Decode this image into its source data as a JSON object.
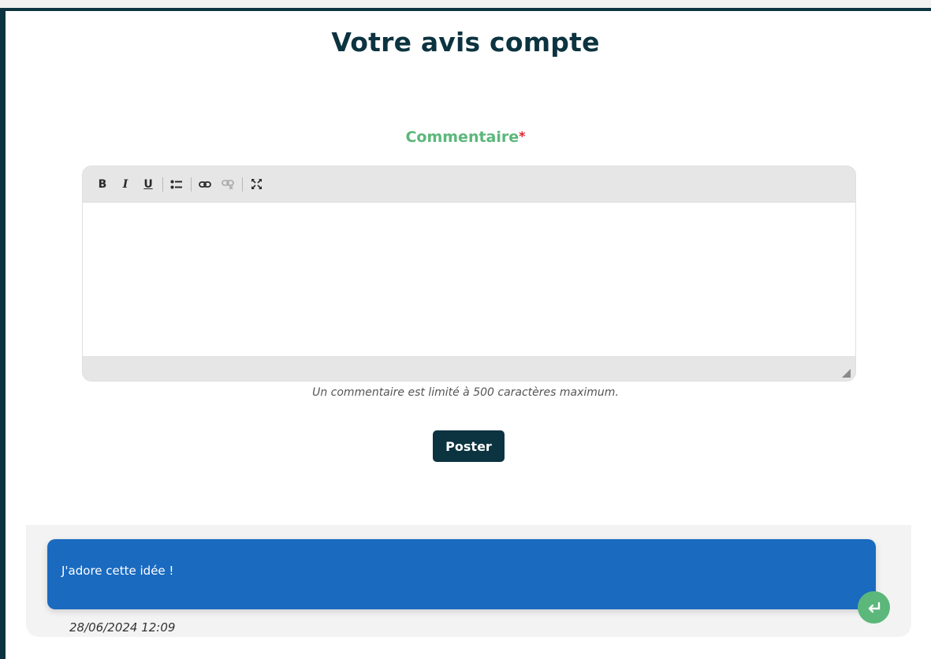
{
  "page": {
    "title": "Votre avis compte"
  },
  "form": {
    "label": "Commentaire",
    "required_marker": "*",
    "toolbar": {
      "bold": "B",
      "italic": "I",
      "underline": "U",
      "icons": [
        "bullet-list-icon",
        "link-icon",
        "unlink-icon",
        "maximize-icon"
      ]
    },
    "textarea_value": "",
    "hint": "Un commentaire est limité à 500 caractères maximum.",
    "submit_label": "Poster"
  },
  "comments": [
    {
      "text": "J'adore cette idée !",
      "date": "28/06/2024 12:09"
    }
  ],
  "colors": {
    "dark": "#0c3340",
    "green": "#5bb77a",
    "blue": "#1a6ac0",
    "required": "#e1242c"
  }
}
